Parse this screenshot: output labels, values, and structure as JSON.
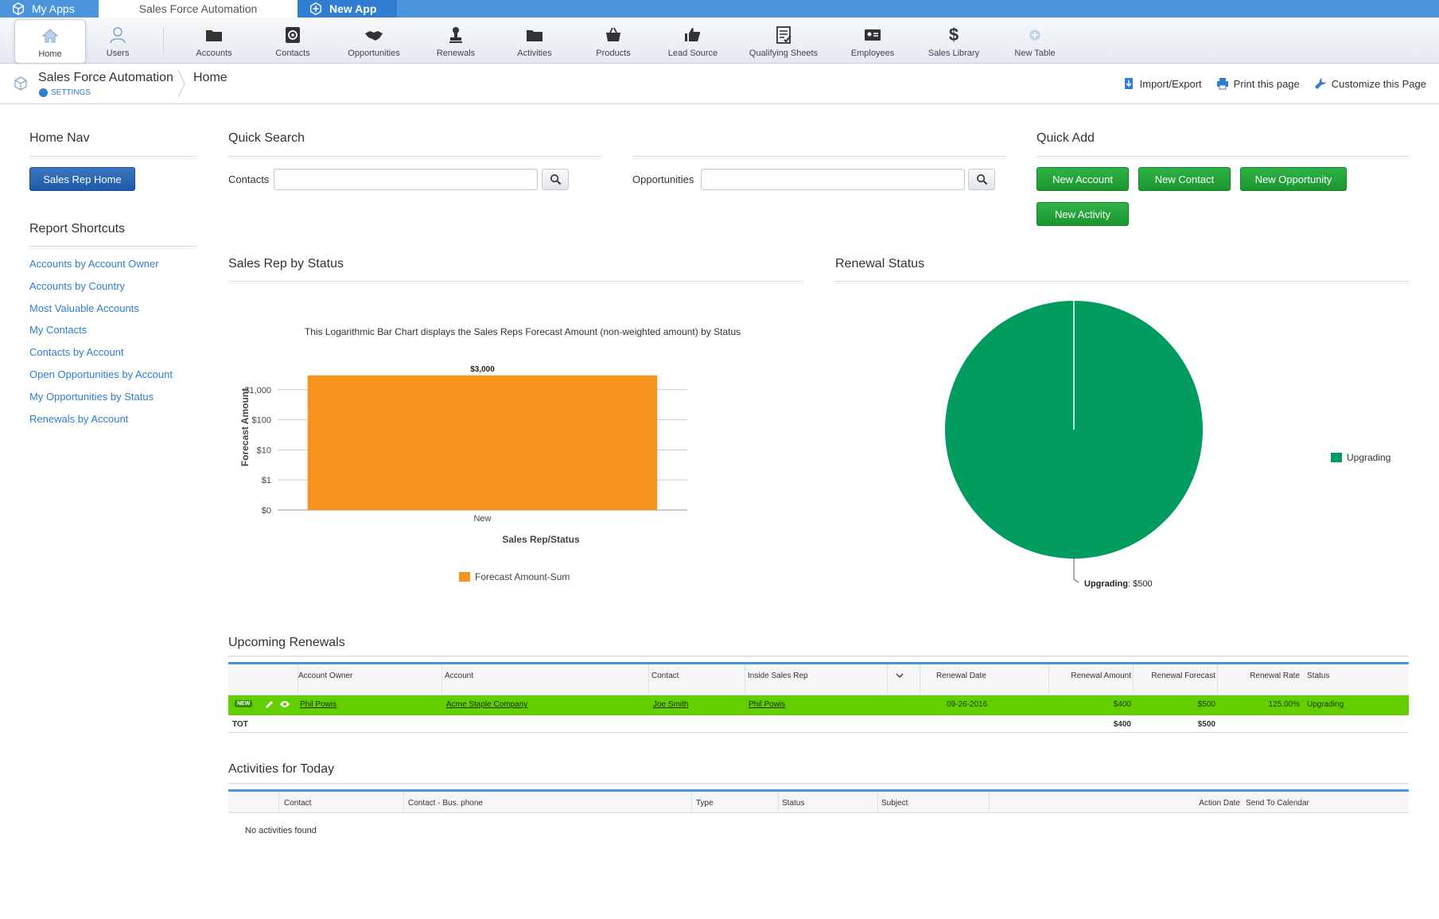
{
  "app_tabs": {
    "my_apps": "My Apps",
    "current": "Sales Force Automation",
    "new_app": "New App"
  },
  "toolbar": {
    "items": [
      {
        "label": "Home",
        "icon": "home-icon"
      },
      {
        "label": "Users",
        "icon": "user-icon"
      },
      {
        "label": "Accounts",
        "icon": "folder-icon"
      },
      {
        "label": "Contacts",
        "icon": "at-sign-icon"
      },
      {
        "label": "Opportunities",
        "icon": "handshake-icon"
      },
      {
        "label": "Renewals",
        "icon": "stamp-icon"
      },
      {
        "label": "Activities",
        "icon": "folder-icon"
      },
      {
        "label": "Products",
        "icon": "basket-icon"
      },
      {
        "label": "Lead Source",
        "icon": "thumbs-up-icon"
      },
      {
        "label": "Qualifying Sheets",
        "icon": "checklist-icon"
      },
      {
        "label": "Employees",
        "icon": "id-card-icon"
      },
      {
        "label": "Sales Library",
        "icon": "dollar-icon"
      },
      {
        "label": "New Table",
        "icon": "plus-circle-icon"
      }
    ]
  },
  "breadcrumb": {
    "app": "Sales Force Automation",
    "settings": "SETTINGS",
    "page": "Home"
  },
  "page_actions": {
    "import_export": "Import/Export",
    "print": "Print this page",
    "customize": "Customize this Page"
  },
  "home_nav": {
    "title": "Home Nav",
    "button": "Sales Rep Home"
  },
  "report_shortcuts": {
    "title": "Report Shortcuts",
    "links": [
      "Accounts by Account Owner",
      "Accounts by Country",
      "Most Valuable Accounts",
      "My Contacts",
      "Contacts by Account",
      "Open Opportunities by Account",
      "My Opportunities by Status",
      "Renewals by Account"
    ]
  },
  "quick_search": {
    "title": "Quick Search",
    "contacts_label": "Contacts",
    "opportunities_label": "Opportunities"
  },
  "quick_add": {
    "title": "Quick Add",
    "buttons": [
      "New Account",
      "New Contact",
      "New Opportunity",
      "New Activity"
    ]
  },
  "colors": {
    "accent": "#4c95dc",
    "bar": "#f7941d",
    "pie": "#009b5f",
    "row_highlight": "#63cf00",
    "button_green": "#22a23a",
    "button_blue": "#2b68b6"
  },
  "chart_data": [
    {
      "type": "bar",
      "section_title": "Sales Rep by Status",
      "title": "This Logarithmic Bar Chart displays the Sales Reps Forecast Amount (non-weighted amount) by Status",
      "categories": [
        "New"
      ],
      "series": [
        {
          "name": "Forecast Amount-Sum",
          "values": [
            3000
          ]
        }
      ],
      "data_labels": [
        "$3,000"
      ],
      "xlabel": "Sales Rep/Status",
      "ylabel": "Forecast Amount",
      "yscale": "log",
      "yticks": [
        {
          "value": 0,
          "label": "$0"
        },
        {
          "value": 1,
          "label": "$1"
        },
        {
          "value": 10,
          "label": "$10"
        },
        {
          "value": 100,
          "label": "$100"
        },
        {
          "value": 1000,
          "label": "$1,000"
        }
      ],
      "grid": true,
      "legend": "bottom"
    },
    {
      "type": "pie",
      "section_title": "Renewal Status",
      "slices": [
        {
          "label": "Upgrading",
          "value": 500,
          "display": "$500"
        }
      ],
      "legend": "right"
    }
  ],
  "upcoming_renewals": {
    "title": "Upcoming Renewals",
    "columns": [
      "Account Owner",
      "Account",
      "Contact",
      "Inside Sales Rep",
      "Renewal Date",
      "Renewal Amount",
      "Renewal Forecast",
      "Renewal Rate",
      "Status"
    ],
    "rows": [
      {
        "tag": "NEW",
        "account_owner": "Phil Powis",
        "account": "Acme Staple Company",
        "contact": "Joe Smith",
        "inside_sales_rep": "Phil Powis",
        "renewal_date": "09-26-2016",
        "renewal_amount": "$400",
        "renewal_forecast": "$500",
        "renewal_rate": "125.00%",
        "status": "Upgrading"
      }
    ],
    "total": {
      "label": "TOT",
      "renewal_amount": "$400",
      "renewal_forecast": "$500"
    }
  },
  "activities_today": {
    "title": "Activities for Today",
    "columns": [
      "Contact",
      "Contact - Bus. phone",
      "Type",
      "Status",
      "Subject",
      "Action Date",
      "Send To Calendar"
    ],
    "empty_text": "No activities found"
  }
}
